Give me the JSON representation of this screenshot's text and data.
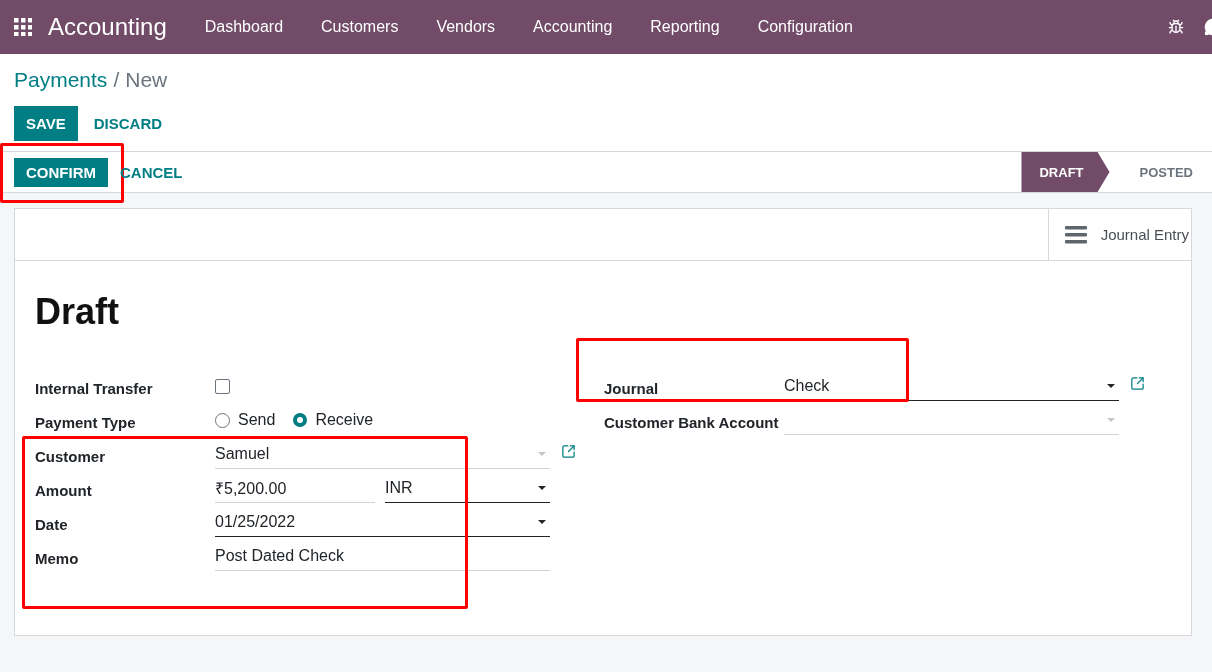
{
  "app": {
    "title": "Accounting"
  },
  "menu": [
    "Dashboard",
    "Customers",
    "Vendors",
    "Accounting",
    "Reporting",
    "Configuration"
  ],
  "breadcrumb": {
    "parent": "Payments",
    "separator": "/",
    "current": "New"
  },
  "actions": [
    {
      "label": "SAVE",
      "kind": "primary"
    },
    {
      "label": "DISCARD",
      "kind": "link"
    }
  ],
  "status_buttons": [
    {
      "label": "CONFIRM",
      "kind": "primary",
      "highlighted": true
    },
    {
      "label": "CANCEL",
      "kind": "link",
      "highlighted": false
    }
  ],
  "stages": [
    {
      "label": "DRAFT",
      "selected": true
    },
    {
      "label": "POSTED",
      "selected": false
    }
  ],
  "smart_button": {
    "label": "Journal Entry"
  },
  "title": "Draft",
  "left_fields": [
    {
      "label": "Internal Transfer",
      "kind": "checkbox",
      "checked": false
    },
    {
      "label": "Payment Type",
      "kind": "radio",
      "options": [
        {
          "label": "Send",
          "selected": false
        },
        {
          "label": "Receive",
          "selected": true
        }
      ]
    }
  ],
  "left_group": {
    "highlighted": true,
    "fields": [
      {
        "label": "Customer",
        "kind": "many2one",
        "value": "Samuel",
        "required": false,
        "external_link": true
      },
      {
        "label": "Amount",
        "kind": "monetary",
        "value": "₹5,200.00",
        "currency": "INR"
      },
      {
        "label": "Date",
        "kind": "date",
        "value": "01/25/2022",
        "required": true
      },
      {
        "label": "Memo",
        "kind": "text",
        "value": "Post Dated Check"
      }
    ]
  },
  "right_fields": [
    {
      "label": "Journal",
      "kind": "many2one",
      "value": "Check",
      "required": true,
      "external_link": true,
      "highlighted": true
    },
    {
      "label": "Customer Bank Account",
      "kind": "many2one",
      "required": false,
      "external_link": false,
      "highlighted": false
    }
  ]
}
